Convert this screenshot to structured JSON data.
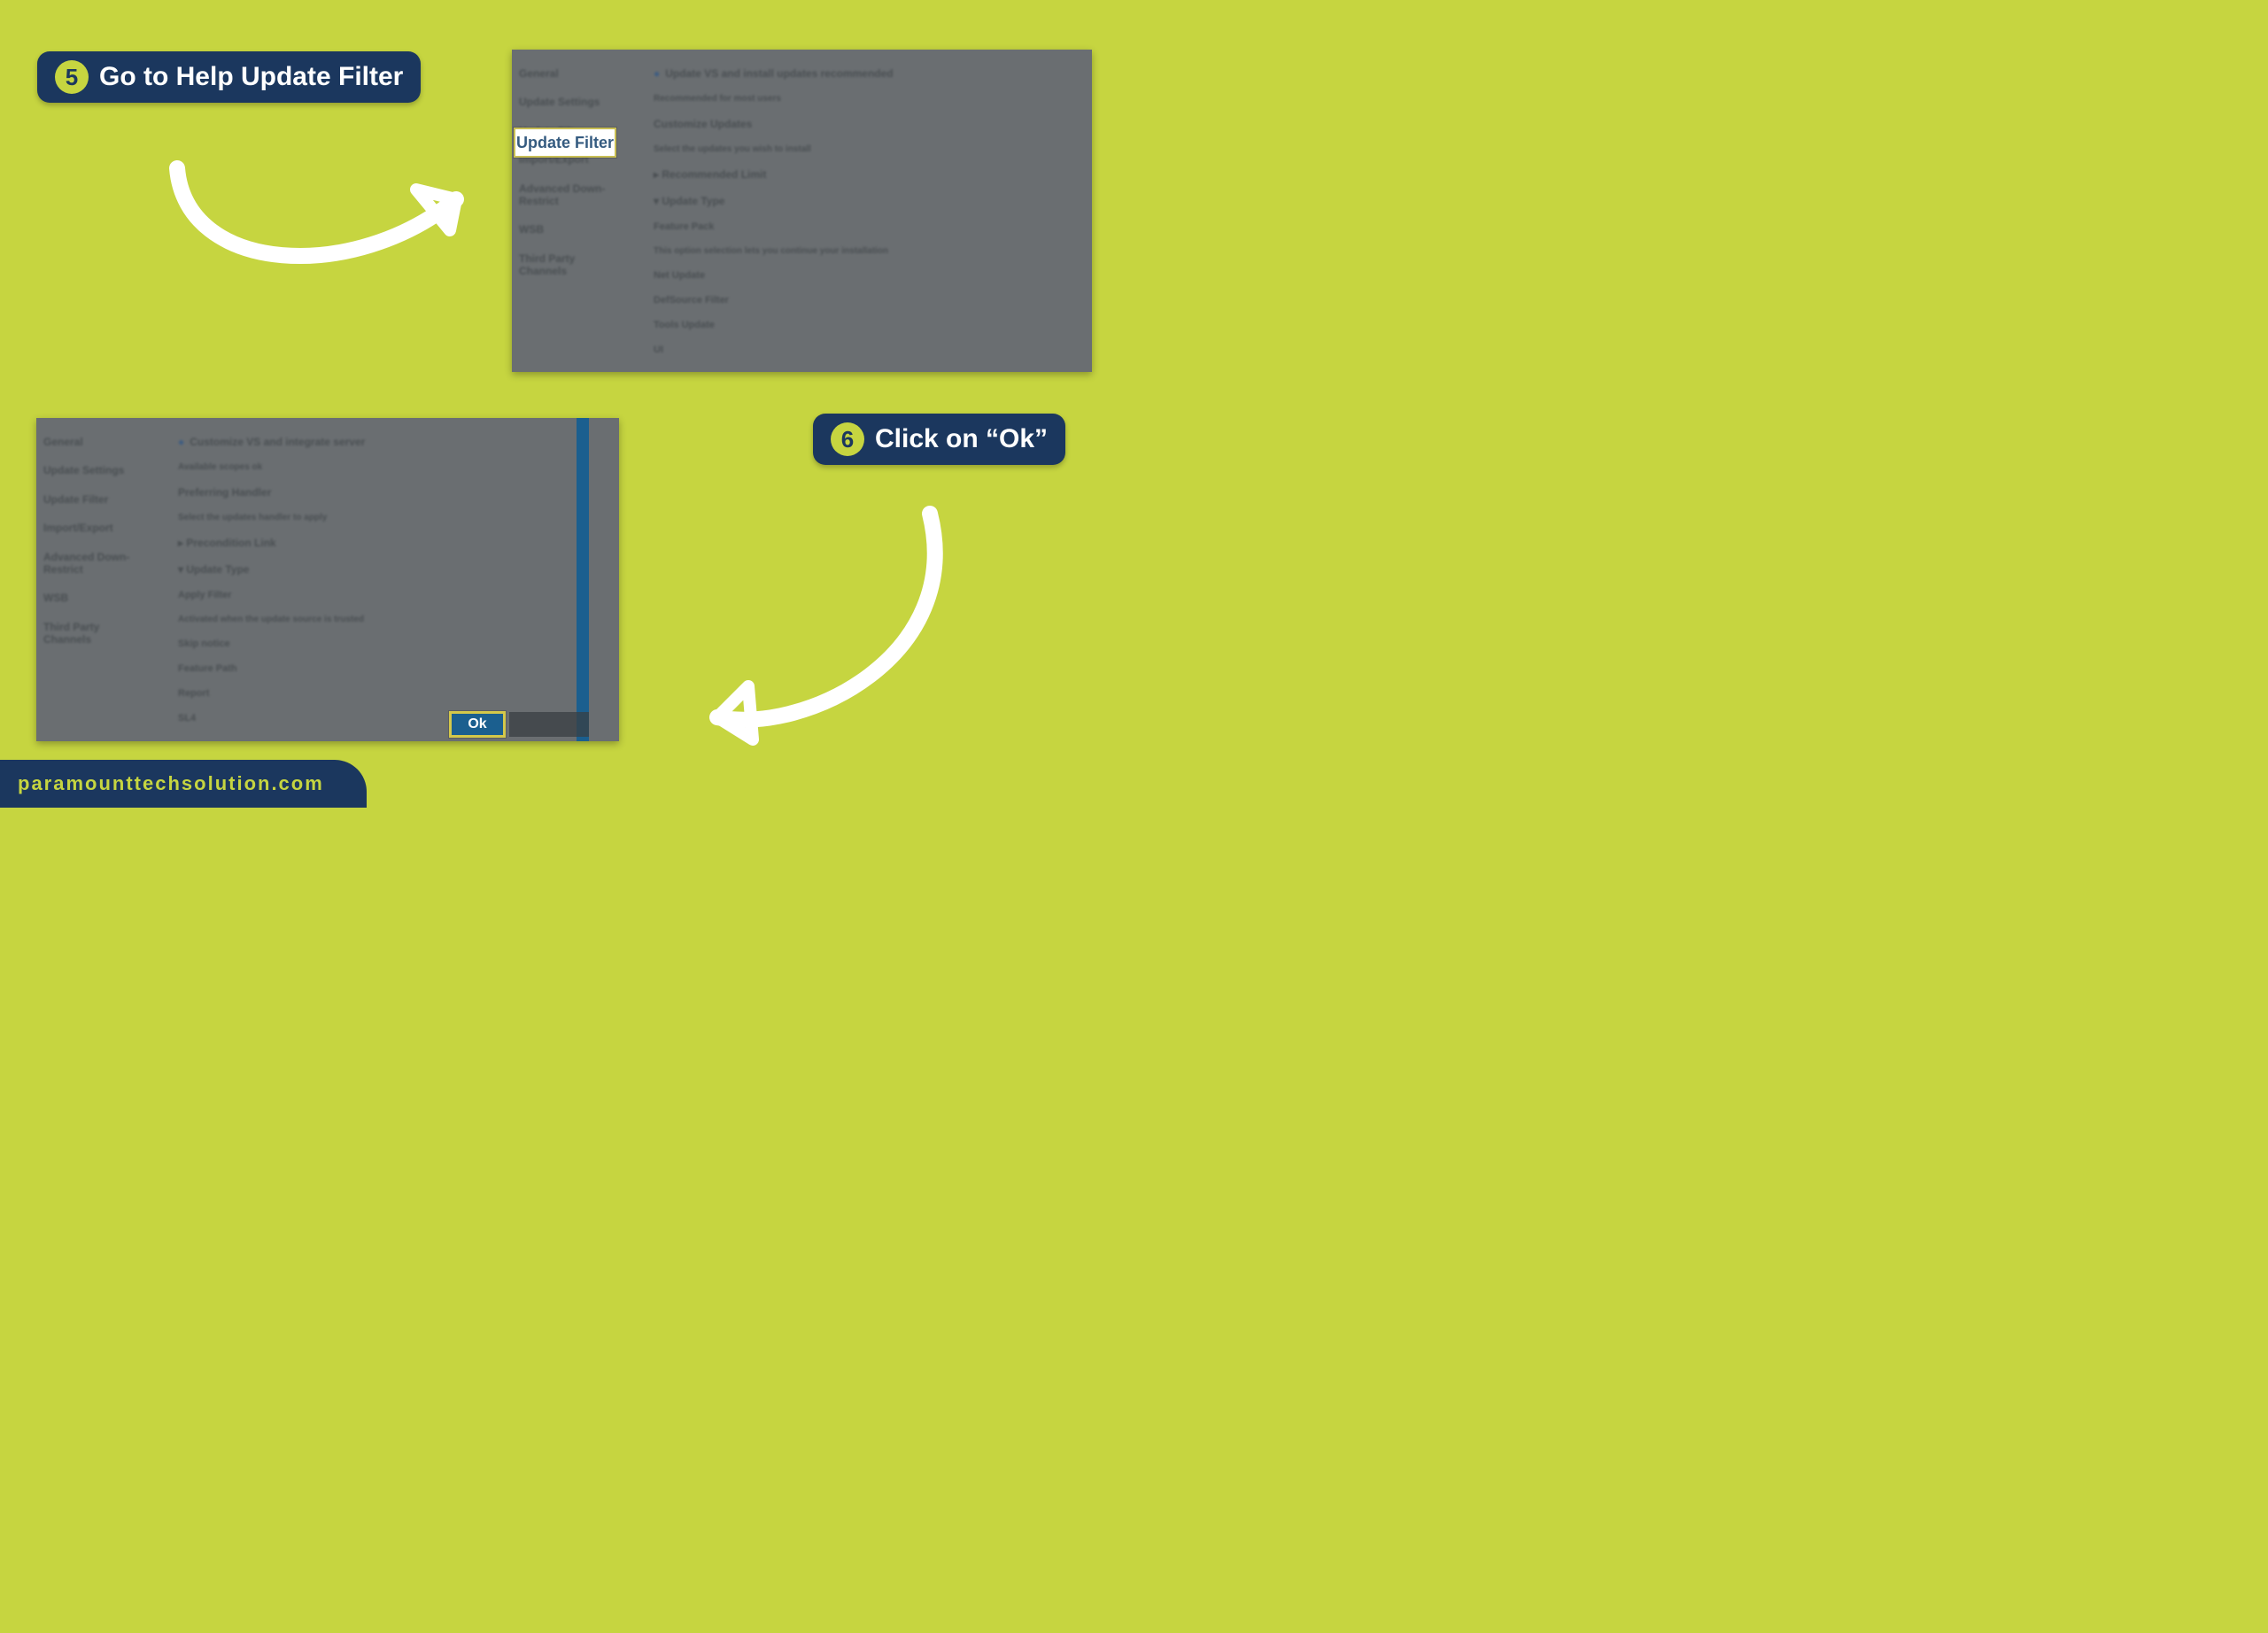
{
  "steps": {
    "five": {
      "num": "5",
      "text": "Go to Help Update Filter"
    },
    "six": {
      "num": "6",
      "text": "Click on “Ok”"
    }
  },
  "highlights": {
    "update_filter": "Update Filter",
    "ok": "Ok"
  },
  "screenshot_a": {
    "sidebar": [
      "General",
      "Update Settings",
      "Update Filter",
      "Import/Export",
      "Advanced Down-Restrict",
      "WSB",
      "Third Party Channels"
    ],
    "body": [
      "Update VS and install updates recommended",
      "Recommended for most users",
      "Customize Updates",
      "Select the updates you wish to install",
      "Recommended Limit",
      "Update Type",
      "Feature Pack",
      "This option selection lets you continue your installation",
      "Net Update",
      "DefSource Filter",
      "Tools Update",
      "UI"
    ]
  },
  "screenshot_b": {
    "sidebar": [
      "General",
      "Update Settings",
      "Update Filter",
      "Import/Export",
      "Advanced Down-Restrict",
      "WSB",
      "Third Party Channels"
    ],
    "body": [
      "Customize VS and integrate server",
      "Available scopes ok",
      "Preferring Handler",
      "Select the updates handler to apply",
      "Precondition Link",
      "Update Type",
      "Apply Filter",
      "Activated when the update source is trusted",
      "Skip notice",
      "Feature Path",
      "Report",
      "SL4"
    ]
  },
  "footer": "paramounttechsolution.com"
}
